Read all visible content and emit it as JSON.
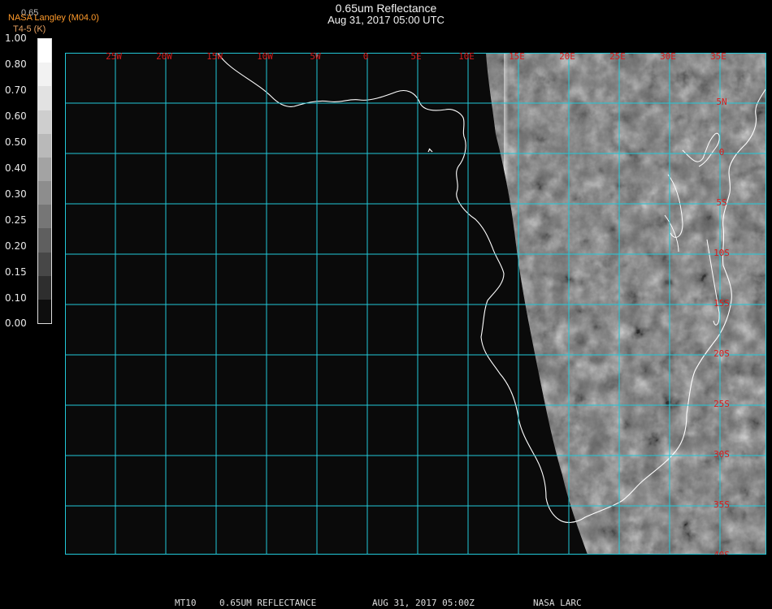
{
  "header": {
    "title": "0.65um Reflectance",
    "subtitle": "Aug 31, 2017 05:00 UTC",
    "source": "NASA Langley (M04.0)",
    "product": "T4-5 (K)",
    "channel_label": "0.65"
  },
  "colorbar": {
    "labels": [
      "1.00",
      "0.80",
      "0.70",
      "0.60",
      "0.50",
      "0.40",
      "0.30",
      "0.25",
      "0.20",
      "0.15",
      "0.10",
      "0.00"
    ],
    "steps": [
      "#ffffff",
      "#f2f2f2",
      "#e2e2e2",
      "#cecece",
      "#b9b9b9",
      "#a3a3a3",
      "#8d8d8d",
      "#767676",
      "#5f5f5f",
      "#474747",
      "#2e2e2e",
      "#0e0e0e"
    ]
  },
  "map": {
    "grid_color": "#22c8d8",
    "label_color": "#d81c1c",
    "lon_labels": [
      "25W",
      "20W",
      "15W",
      "10W",
      "5W",
      "0",
      "5E",
      "10E",
      "15E",
      "20E",
      "25E",
      "30E",
      "35E"
    ],
    "lat_labels": [
      "5N",
      "0",
      "5S",
      "10S",
      "15S",
      "20S",
      "25S",
      "30S",
      "35S",
      "40S"
    ]
  },
  "footer": {
    "satellite": "MT10",
    "product": "0.65UM REFLECTANCE",
    "datetime": "AUG 31, 2017 05:00Z",
    "org": "NASA LARC"
  }
}
